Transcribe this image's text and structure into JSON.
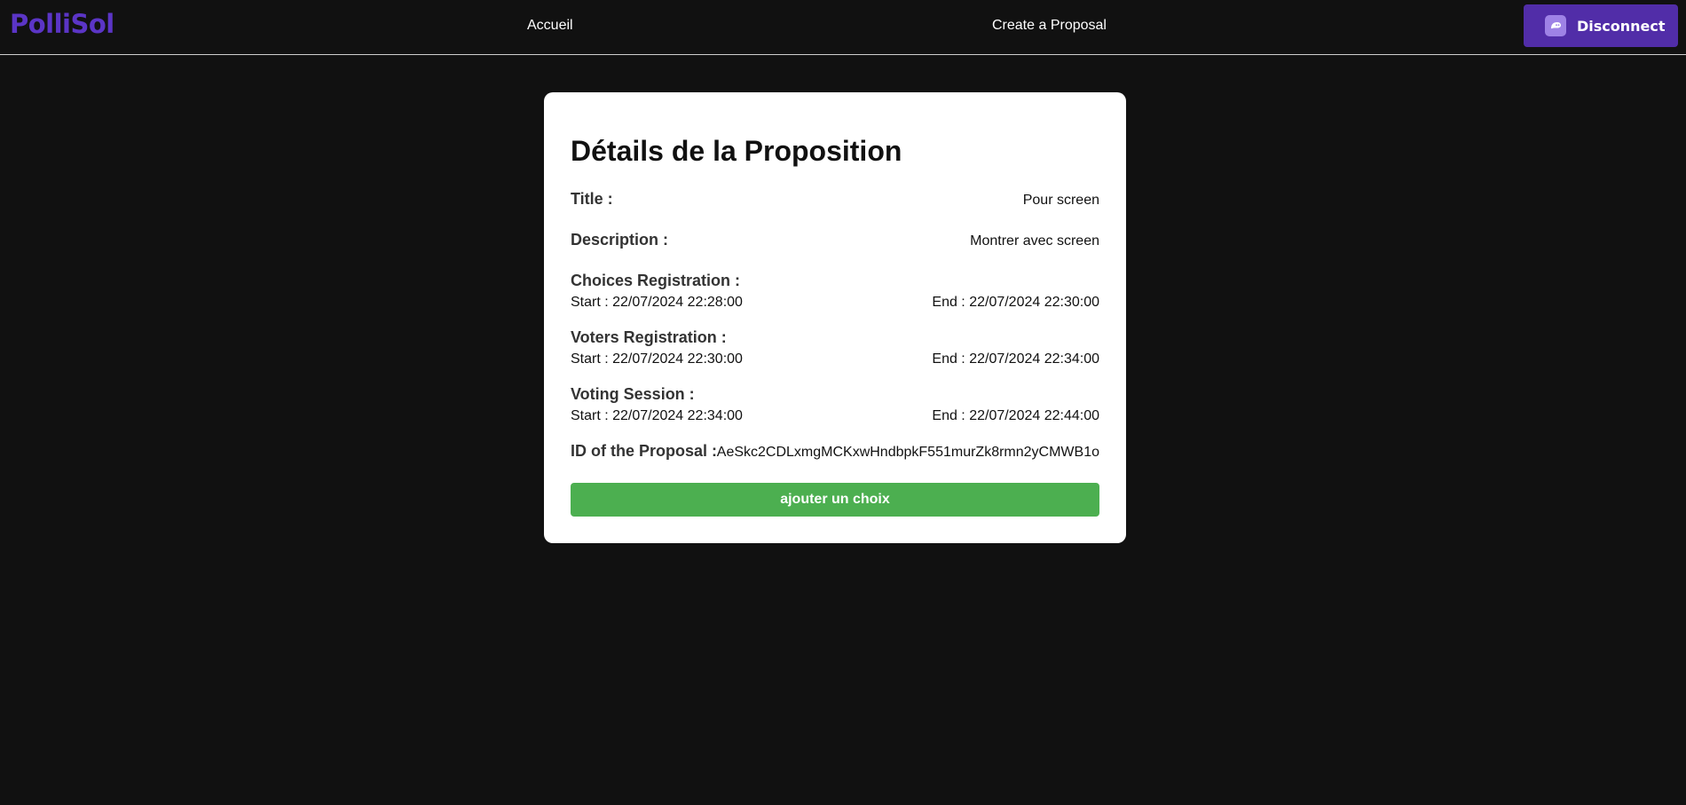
{
  "navbar": {
    "brand": "PolliSol",
    "links": [
      {
        "label": "Accueil"
      },
      {
        "label": "Create a Proposal"
      }
    ],
    "wallet_button_label": "Disconnect"
  },
  "proposal": {
    "heading": "Détails de la Proposition",
    "title_label": "Title :",
    "title_value": "Pour screen",
    "description_label": "Description :",
    "description_value": "Montrer avec screen",
    "choices_registration": {
      "label": "Choices Registration :",
      "start": "Start : 22/07/2024 22:28:00",
      "end": "End : 22/07/2024 22:30:00"
    },
    "voters_registration": {
      "label": "Voters Registration :",
      "start": "Start : 22/07/2024 22:30:00",
      "end": "End : 22/07/2024 22:34:00"
    },
    "voting_session": {
      "label": "Voting Session :",
      "start": "Start : 22/07/2024 22:34:00",
      "end": "End : 22/07/2024 22:44:00"
    },
    "id_label": "ID of the Proposal :",
    "id_value": "AeSkc2CDLxmgMCKxwHndbpkF551murZk8rmn2yCMWB1o",
    "add_choice_label": "ajouter un choix"
  },
  "colors": {
    "brand": "#5b35c6",
    "wallet_button": "#512da8",
    "add_button": "#4caf50",
    "background": "#111111"
  }
}
